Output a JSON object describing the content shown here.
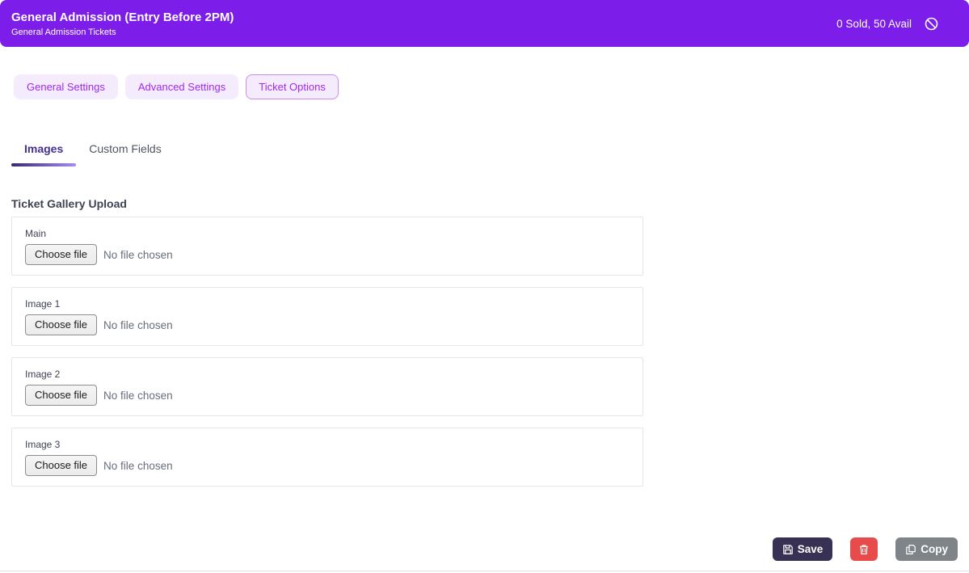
{
  "header": {
    "title": "General Admission (Entry Before 2PM)",
    "subtitle": "General Admission Tickets",
    "stats": "0 Sold, 50 Avail"
  },
  "tabs": [
    {
      "label": "General Settings",
      "active": false
    },
    {
      "label": "Advanced Settings",
      "active": false
    },
    {
      "label": "Ticket Options",
      "active": true
    }
  ],
  "subtabs": [
    {
      "label": "Images",
      "active": true
    },
    {
      "label": "Custom Fields",
      "active": false
    }
  ],
  "section": {
    "title": "Ticket Gallery Upload",
    "uploads": [
      {
        "label": "Main",
        "button": "Choose file",
        "status": "No file chosen"
      },
      {
        "label": "Image 1",
        "button": "Choose file",
        "status": "No file chosen"
      },
      {
        "label": "Image 2",
        "button": "Choose file",
        "status": "No file chosen"
      },
      {
        "label": "Image 3",
        "button": "Choose file",
        "status": "No file chosen"
      }
    ]
  },
  "actions": {
    "save": "Save",
    "copy": "Copy"
  },
  "colors": {
    "header_purple": "#7c1de9",
    "pill_bg": "#f4ecfd",
    "pill_text": "#a02af0",
    "pill_active_border": "#c98cf7",
    "subtab_active": "#44308f",
    "save_button": "#393153",
    "delete_button": "#e84b4b",
    "copy_button": "#7f8488"
  }
}
